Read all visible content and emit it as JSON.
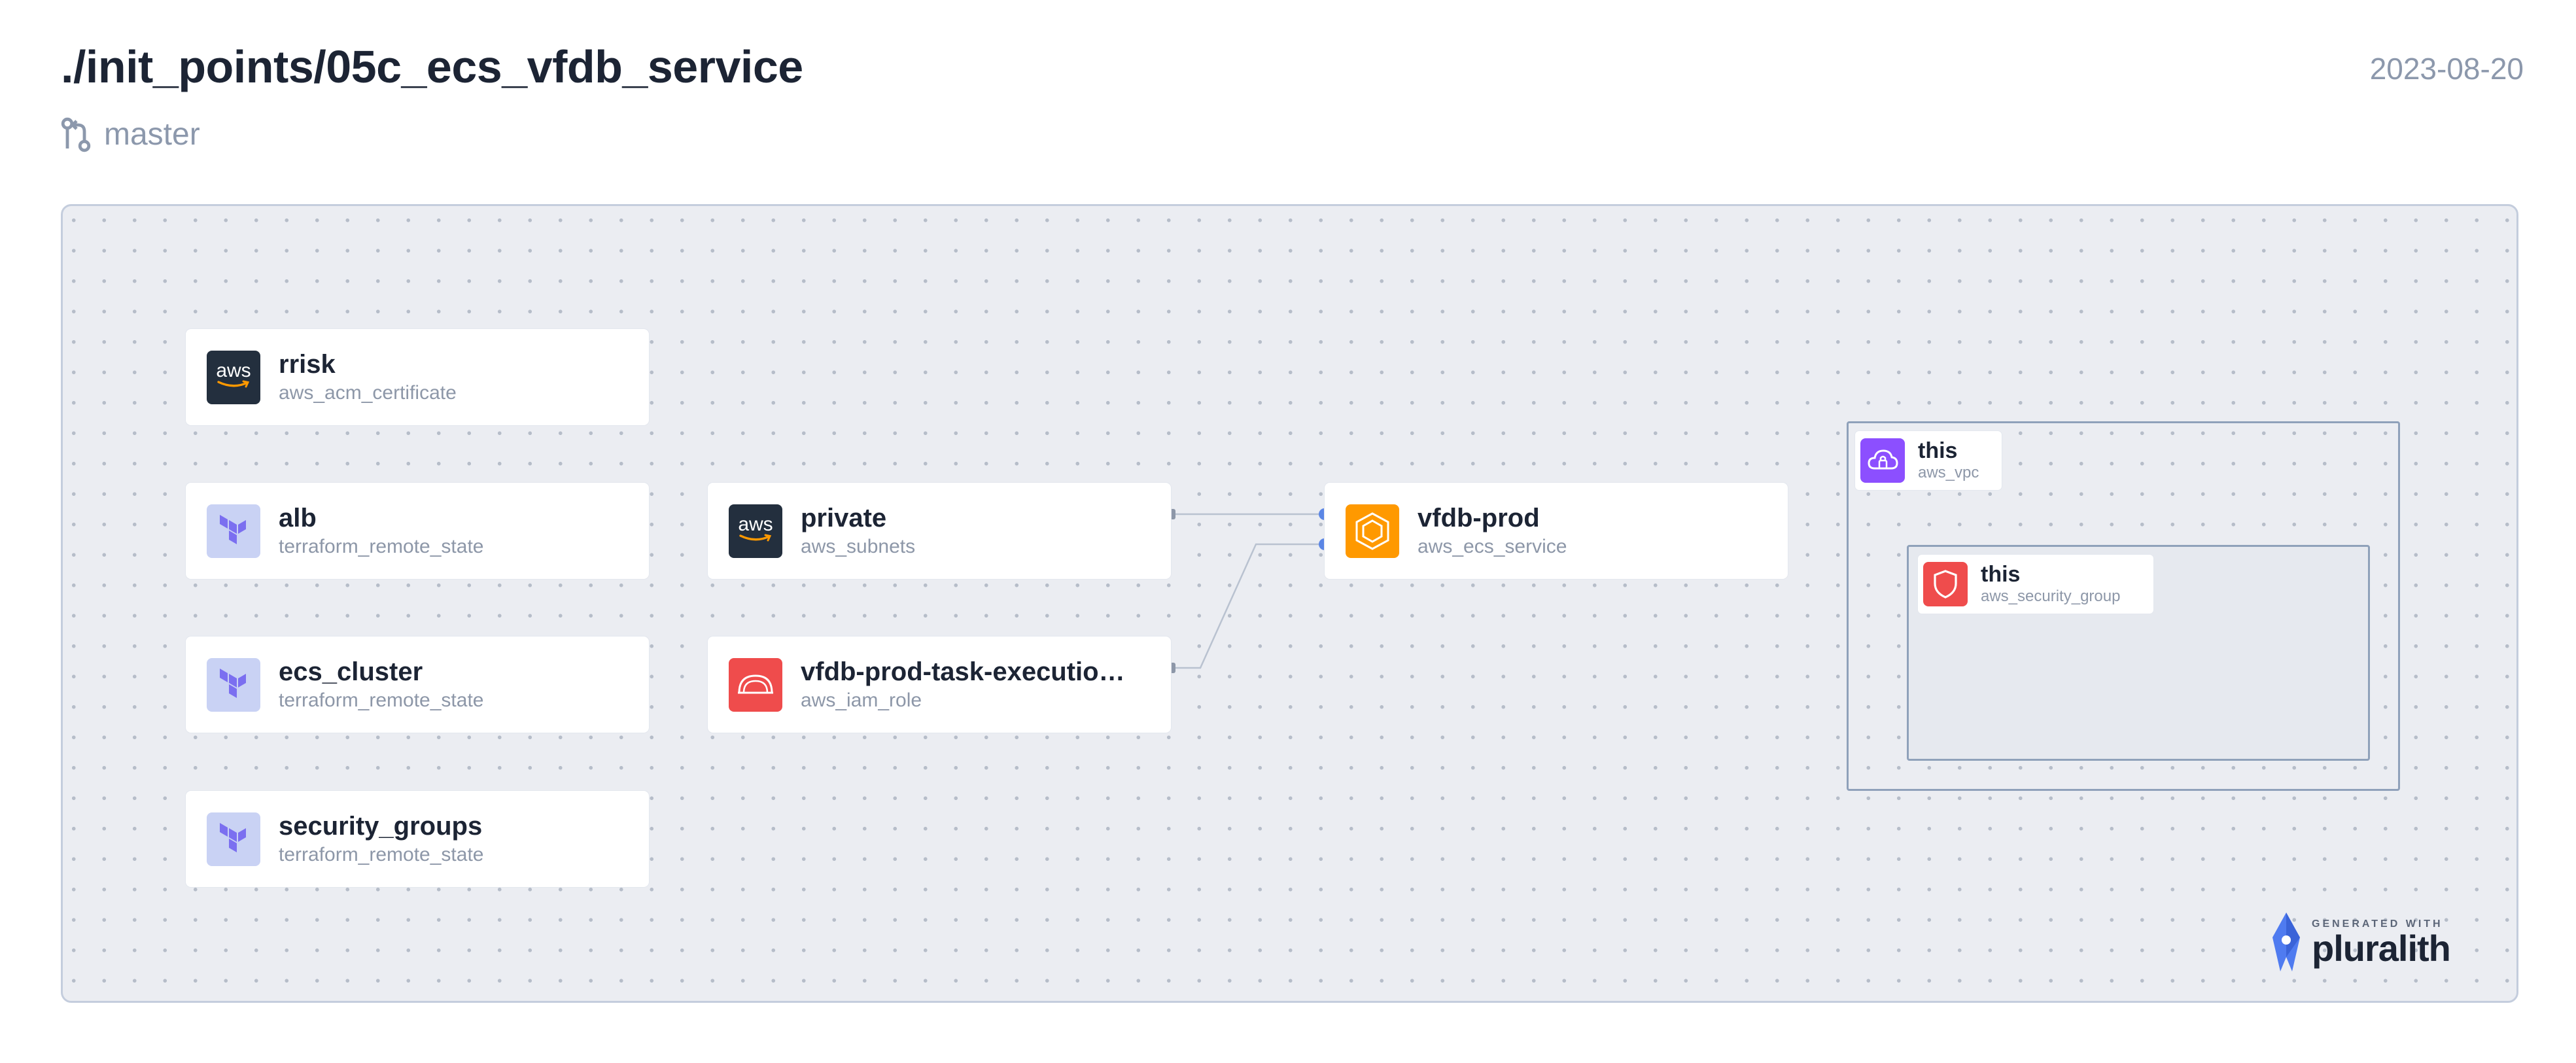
{
  "header": {
    "title": "./init_points/05c_ecs_vfdb_service",
    "branch": "master",
    "date": "2023-08-20"
  },
  "nodes": [
    {
      "name": "rrisk",
      "type": "aws_acm_certificate",
      "icon": "aws-logo-icon"
    },
    {
      "name": "alb",
      "type": "terraform_remote_state",
      "icon": "terraform-icon"
    },
    {
      "name": "ecs_cluster",
      "type": "terraform_remote_state",
      "icon": "terraform-icon"
    },
    {
      "name": "security_groups",
      "type": "terraform_remote_state",
      "icon": "terraform-icon"
    },
    {
      "name": "private",
      "type": "aws_subnets",
      "icon": "aws-logo-icon"
    },
    {
      "name": "vfdb-prod-task-executio…",
      "type": "aws_iam_role",
      "icon": "iam-role-icon"
    },
    {
      "name": "vfdb-prod",
      "type": "aws_ecs_service",
      "icon": "ecs-service-icon"
    }
  ],
  "groups": [
    {
      "name": "this",
      "type": "aws_vpc",
      "icon": "vpc-cloud-icon"
    },
    {
      "name": "this",
      "type": "aws_security_group",
      "icon": "shield-icon"
    }
  ],
  "edges": [
    {
      "from": "private",
      "to": "vfdb-prod"
    },
    {
      "from": "vfdb-prod-task-executio…",
      "to": "vfdb-prod"
    }
  ],
  "aws_logo_text": "aws",
  "footer": {
    "generated_with": "GENERATED WITH",
    "brand": "pluralith"
  },
  "colors": {
    "terraform": "#7b42bc",
    "ecs": "#ff9900",
    "iam": "#ef4c4c",
    "vpc": "#8c4fff",
    "connector": "#5b86e5"
  }
}
